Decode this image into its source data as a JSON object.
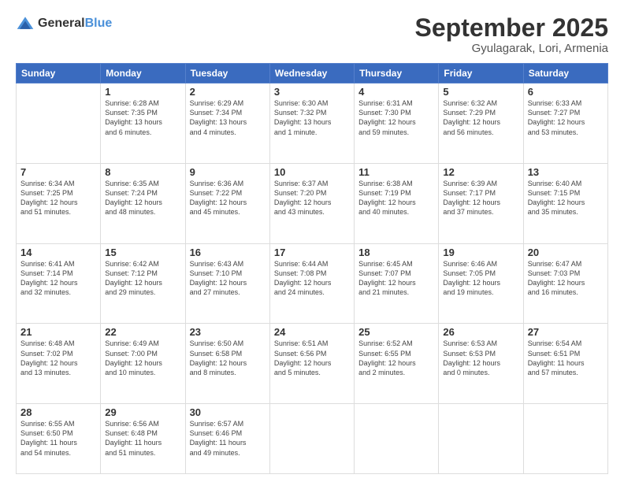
{
  "logo": {
    "general": "General",
    "blue": "Blue"
  },
  "header": {
    "month": "September 2025",
    "location": "Gyulagarak, Lori, Armenia"
  },
  "days_of_week": [
    "Sunday",
    "Monday",
    "Tuesday",
    "Wednesday",
    "Thursday",
    "Friday",
    "Saturday"
  ],
  "weeks": [
    [
      {
        "day": "",
        "info": ""
      },
      {
        "day": "1",
        "info": "Sunrise: 6:28 AM\nSunset: 7:35 PM\nDaylight: 13 hours\nand 6 minutes."
      },
      {
        "day": "2",
        "info": "Sunrise: 6:29 AM\nSunset: 7:34 PM\nDaylight: 13 hours\nand 4 minutes."
      },
      {
        "day": "3",
        "info": "Sunrise: 6:30 AM\nSunset: 7:32 PM\nDaylight: 13 hours\nand 1 minute."
      },
      {
        "day": "4",
        "info": "Sunrise: 6:31 AM\nSunset: 7:30 PM\nDaylight: 12 hours\nand 59 minutes."
      },
      {
        "day": "5",
        "info": "Sunrise: 6:32 AM\nSunset: 7:29 PM\nDaylight: 12 hours\nand 56 minutes."
      },
      {
        "day": "6",
        "info": "Sunrise: 6:33 AM\nSunset: 7:27 PM\nDaylight: 12 hours\nand 53 minutes."
      }
    ],
    [
      {
        "day": "7",
        "info": "Sunrise: 6:34 AM\nSunset: 7:25 PM\nDaylight: 12 hours\nand 51 minutes."
      },
      {
        "day": "8",
        "info": "Sunrise: 6:35 AM\nSunset: 7:24 PM\nDaylight: 12 hours\nand 48 minutes."
      },
      {
        "day": "9",
        "info": "Sunrise: 6:36 AM\nSunset: 7:22 PM\nDaylight: 12 hours\nand 45 minutes."
      },
      {
        "day": "10",
        "info": "Sunrise: 6:37 AM\nSunset: 7:20 PM\nDaylight: 12 hours\nand 43 minutes."
      },
      {
        "day": "11",
        "info": "Sunrise: 6:38 AM\nSunset: 7:19 PM\nDaylight: 12 hours\nand 40 minutes."
      },
      {
        "day": "12",
        "info": "Sunrise: 6:39 AM\nSunset: 7:17 PM\nDaylight: 12 hours\nand 37 minutes."
      },
      {
        "day": "13",
        "info": "Sunrise: 6:40 AM\nSunset: 7:15 PM\nDaylight: 12 hours\nand 35 minutes."
      }
    ],
    [
      {
        "day": "14",
        "info": "Sunrise: 6:41 AM\nSunset: 7:14 PM\nDaylight: 12 hours\nand 32 minutes."
      },
      {
        "day": "15",
        "info": "Sunrise: 6:42 AM\nSunset: 7:12 PM\nDaylight: 12 hours\nand 29 minutes."
      },
      {
        "day": "16",
        "info": "Sunrise: 6:43 AM\nSunset: 7:10 PM\nDaylight: 12 hours\nand 27 minutes."
      },
      {
        "day": "17",
        "info": "Sunrise: 6:44 AM\nSunset: 7:08 PM\nDaylight: 12 hours\nand 24 minutes."
      },
      {
        "day": "18",
        "info": "Sunrise: 6:45 AM\nSunset: 7:07 PM\nDaylight: 12 hours\nand 21 minutes."
      },
      {
        "day": "19",
        "info": "Sunrise: 6:46 AM\nSunset: 7:05 PM\nDaylight: 12 hours\nand 19 minutes."
      },
      {
        "day": "20",
        "info": "Sunrise: 6:47 AM\nSunset: 7:03 PM\nDaylight: 12 hours\nand 16 minutes."
      }
    ],
    [
      {
        "day": "21",
        "info": "Sunrise: 6:48 AM\nSunset: 7:02 PM\nDaylight: 12 hours\nand 13 minutes."
      },
      {
        "day": "22",
        "info": "Sunrise: 6:49 AM\nSunset: 7:00 PM\nDaylight: 12 hours\nand 10 minutes."
      },
      {
        "day": "23",
        "info": "Sunrise: 6:50 AM\nSunset: 6:58 PM\nDaylight: 12 hours\nand 8 minutes."
      },
      {
        "day": "24",
        "info": "Sunrise: 6:51 AM\nSunset: 6:56 PM\nDaylight: 12 hours\nand 5 minutes."
      },
      {
        "day": "25",
        "info": "Sunrise: 6:52 AM\nSunset: 6:55 PM\nDaylight: 12 hours\nand 2 minutes."
      },
      {
        "day": "26",
        "info": "Sunrise: 6:53 AM\nSunset: 6:53 PM\nDaylight: 12 hours\nand 0 minutes."
      },
      {
        "day": "27",
        "info": "Sunrise: 6:54 AM\nSunset: 6:51 PM\nDaylight: 11 hours\nand 57 minutes."
      }
    ],
    [
      {
        "day": "28",
        "info": "Sunrise: 6:55 AM\nSunset: 6:50 PM\nDaylight: 11 hours\nand 54 minutes."
      },
      {
        "day": "29",
        "info": "Sunrise: 6:56 AM\nSunset: 6:48 PM\nDaylight: 11 hours\nand 51 minutes."
      },
      {
        "day": "30",
        "info": "Sunrise: 6:57 AM\nSunset: 6:46 PM\nDaylight: 11 hours\nand 49 minutes."
      },
      {
        "day": "",
        "info": ""
      },
      {
        "day": "",
        "info": ""
      },
      {
        "day": "",
        "info": ""
      },
      {
        "day": "",
        "info": ""
      }
    ]
  ]
}
